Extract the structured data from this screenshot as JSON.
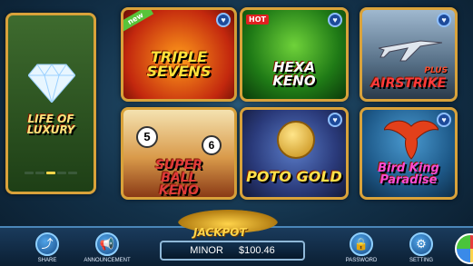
{
  "games": [
    {
      "title": "LIFE OF LUXURY",
      "badge": ""
    },
    {
      "title": "TRIPLE SEVENS",
      "badge": "new"
    },
    {
      "title": "HEXA KENO",
      "badge": "HOT"
    },
    {
      "title": "AIRSTRIKE",
      "badge": ""
    },
    {
      "title": "SUPER BALL KENO",
      "badge": ""
    },
    {
      "title": "POTO GOLD",
      "badge": ""
    },
    {
      "title": "Bird King Paradise",
      "badge": ""
    }
  ],
  "airstrike_tag": "PLUS",
  "jackpot": {
    "label": "JACKPOT",
    "tier": "MINOR",
    "amount": "$100.46"
  },
  "nav": {
    "share": "SHARE",
    "announcement": "ANNOUNCEMENT",
    "password": "PASSWORD",
    "setting": "SETTING"
  }
}
